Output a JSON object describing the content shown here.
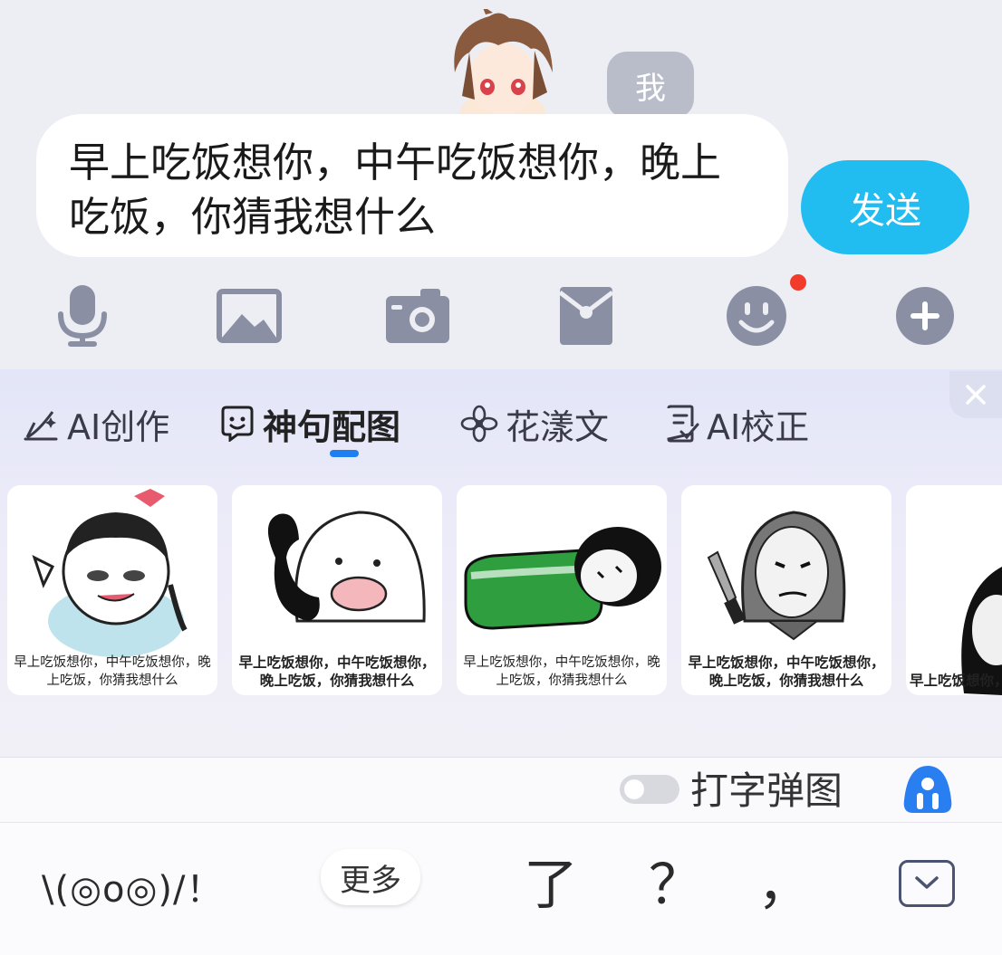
{
  "chat": {
    "sender_badge": "我",
    "input_value": "早上吃饭想你，中午吃饭想你，晚上吃饭，你猜我想什么",
    "send_label": "发送"
  },
  "toolbar": {
    "icons": [
      "microphone-icon",
      "image-icon",
      "camera-icon",
      "red-envelope-icon",
      "emoji-icon",
      "plus-icon"
    ],
    "emoji_has_notification": true
  },
  "panel": {
    "tabs": [
      {
        "label": "AI创作",
        "icon": "pen-sparkle-icon"
      },
      {
        "label": "神句配图",
        "icon": "smile-chat-icon",
        "active": true
      },
      {
        "label": "花漾文",
        "icon": "flower-icon"
      },
      {
        "label": "AI校正",
        "icon": "doc-check-icon"
      }
    ],
    "cards": [
      {
        "caption": "早上吃饭想你，中午吃饭想你，晚上吃饭，你猜我想什么"
      },
      {
        "caption": "早上吃饭想你，中午吃饭想你，晚上吃饭，你猜我想什么"
      },
      {
        "caption": "早上吃饭想你，中午吃饭想你，晚上吃饭，你猜我想什么"
      },
      {
        "caption": "早上吃饭想你，中午吃饭想你，晚上吃饭，你猜我想什么"
      },
      {
        "caption": "早上吃饭想你，中午吃饭想你，晚上吃饭，你猜我想什么"
      }
    ]
  },
  "settings": {
    "typing_popup_label": "打字弹图",
    "typing_popup_enabled": false
  },
  "keyboard": {
    "kaomoji": "\\(◎o◎)/！",
    "more_label": "更多",
    "suggestions": [
      "了",
      "？",
      "，"
    ]
  },
  "colors": {
    "accent": "#21bdf0",
    "tab_indicator": "#1e7ff0",
    "icon_gray": "#8a8fa3",
    "notification": "#f23b2a"
  }
}
